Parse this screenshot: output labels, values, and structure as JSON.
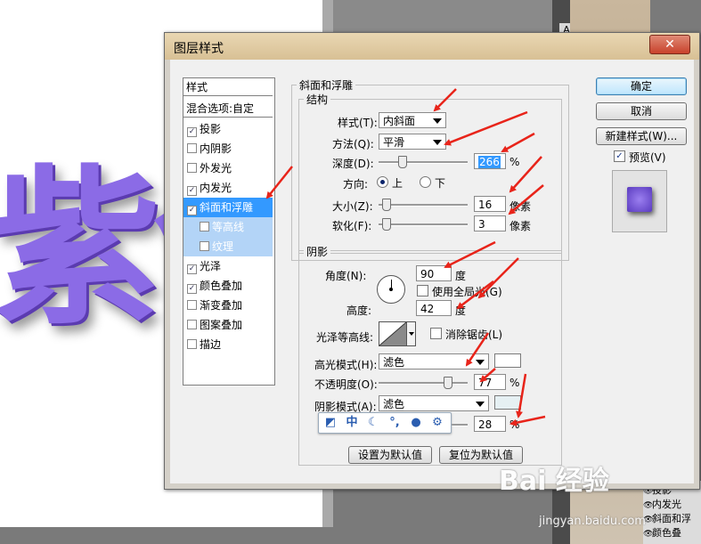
{
  "dialog": {
    "title": "图层样式",
    "close_label": "✕"
  },
  "styles": {
    "header": "样式",
    "blend_options": "混合选项:自定",
    "items": [
      {
        "label": "投影",
        "checked": true
      },
      {
        "label": "内阴影",
        "checked": false
      },
      {
        "label": "外发光",
        "checked": false
      },
      {
        "label": "内发光",
        "checked": true
      },
      {
        "label": "斜面和浮雕",
        "checked": true,
        "selected": true
      },
      {
        "label": "等高线",
        "checked": false,
        "sub": true
      },
      {
        "label": "纹理",
        "checked": false,
        "sub": true
      },
      {
        "label": "光泽",
        "checked": true
      },
      {
        "label": "颜色叠加",
        "checked": true
      },
      {
        "label": "渐变叠加",
        "checked": false
      },
      {
        "label": "图案叠加",
        "checked": false
      },
      {
        "label": "描边",
        "checked": false
      }
    ]
  },
  "bevel": {
    "group_title": "斜面和浮雕",
    "structure_title": "结构",
    "style_label": "样式(T):",
    "style_value": "内斜面",
    "technique_label": "方法(Q):",
    "technique_value": "平滑",
    "depth_label": "深度(D):",
    "depth_value": "266",
    "depth_unit": "%",
    "direction_label": "方向:",
    "direction_up": "上",
    "direction_down": "下",
    "size_label": "大小(Z):",
    "size_value": "16",
    "size_unit": "像素",
    "soften_label": "软化(F):",
    "soften_value": "3",
    "soften_unit": "像素"
  },
  "shading": {
    "title": "阴影",
    "angle_label": "角度(N):",
    "angle_value": "90",
    "angle_unit": "度",
    "global_light_label": "使用全局光(G)",
    "altitude_label": "高度:",
    "altitude_value": "42",
    "altitude_unit": "度",
    "gloss_contour_label": "光泽等高线:",
    "antialias_label": "消除锯齿(L)",
    "highlight_mode_label": "高光模式(H):",
    "highlight_mode_value": "滤色",
    "highlight_opacity_label": "不透明度(O):",
    "highlight_opacity_value": "77",
    "highlight_opacity_unit": "%",
    "shadow_mode_label": "阴影模式(A):",
    "shadow_mode_value": "滤色",
    "shadow_opacity_value": "28",
    "shadow_opacity_unit": "%"
  },
  "footer": {
    "set_default": "设置为默认值",
    "reset_default": "复位为默认值"
  },
  "side_buttons": {
    "ok": "确定",
    "cancel": "取消",
    "new_style": "新建样式(W)...",
    "preview_label": "预览(V)"
  },
  "ime_toolbar": {
    "icons": [
      "ime-logo-icon",
      "chinese-mode-icon",
      "moon-icon",
      "punctuation-icon",
      "user-icon",
      "gear-icon"
    ],
    "mode_label": "中"
  },
  "background": {
    "canvas_text": "紫色",
    "panel_letter": "A",
    "layers": [
      "投影",
      "内发光",
      "斜面和浮",
      "颜色叠"
    ],
    "watermark": "Bai 经验",
    "watermark_url": "jingyan.baidu.com"
  },
  "colors": {
    "highlight_swatch": "#ffffff",
    "shadow_swatch": "#e6f0f3",
    "selection": "#3399ff",
    "arrow": "#e8241a"
  }
}
